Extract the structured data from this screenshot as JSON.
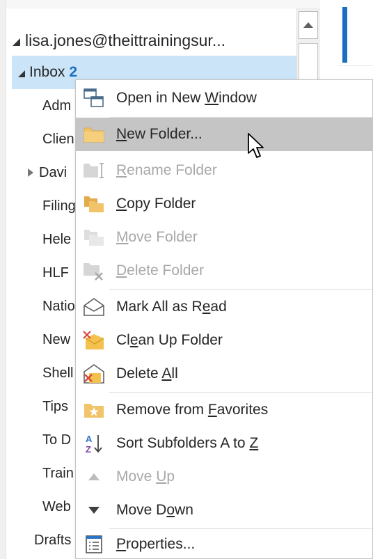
{
  "account": {
    "label": "lisa.jones@theittrainingsur..."
  },
  "inbox": {
    "label": "Inbox",
    "count": "2"
  },
  "folders": [
    {
      "label": "Adm"
    },
    {
      "label": "Clien"
    },
    {
      "label": "Davi",
      "expandable": true
    },
    {
      "label": "Filing"
    },
    {
      "label": "Hele"
    },
    {
      "label": "HLF"
    },
    {
      "label": "Natio"
    },
    {
      "label": "New"
    },
    {
      "label": "Shell"
    },
    {
      "label": "Tips"
    },
    {
      "label": "To D"
    },
    {
      "label": "Train"
    },
    {
      "label": "Web"
    },
    {
      "label": "Drafts"
    }
  ],
  "menu": {
    "items": [
      {
        "id": "open-new-window",
        "pre": "Open in New ",
        "mn": "W",
        "post": "indow",
        "icon": "open-window-icon",
        "enabled": true
      },
      {
        "id": "new-folder",
        "pre": "",
        "mn": "N",
        "post": "ew Folder...",
        "icon": "new-folder-icon",
        "enabled": true,
        "highlighted": true
      },
      {
        "id": "rename-folder",
        "pre": "",
        "mn": "R",
        "post": "ename Folder",
        "icon": "rename-folder-icon",
        "enabled": false
      },
      {
        "id": "copy-folder",
        "pre": "",
        "mn": "C",
        "post": "opy Folder",
        "icon": "copy-folder-icon",
        "enabled": true
      },
      {
        "id": "move-folder",
        "pre": "",
        "mn": "M",
        "post": "ove Folder",
        "icon": "move-folder-icon",
        "enabled": false
      },
      {
        "id": "delete-folder",
        "pre": "",
        "mn": "D",
        "post": "elete Folder",
        "icon": "delete-folder-icon",
        "enabled": false
      },
      {
        "id": "mark-all-read",
        "pre": "Mark All as R",
        "mn": "e",
        "post": "ad",
        "icon": "envelope-open-icon",
        "enabled": true
      },
      {
        "id": "clean-up-folder",
        "pre": "Cl",
        "mn": "e",
        "post": "an Up Folder",
        "icon": "clean-up-icon",
        "enabled": true
      },
      {
        "id": "delete-all",
        "pre": "Delete ",
        "mn": "A",
        "post": "ll",
        "icon": "delete-all-icon",
        "enabled": true
      },
      {
        "id": "remove-favorites",
        "pre": "Remove from ",
        "mn": "F",
        "post": "avorites",
        "icon": "favorites-folder-icon",
        "enabled": true
      },
      {
        "id": "sort-subfolders",
        "pre": "Sort Subfolders A to ",
        "mn": "Z",
        "post": "",
        "icon": "sort-az-icon",
        "enabled": true
      },
      {
        "id": "move-up",
        "pre": "Move ",
        "mn": "U",
        "post": "p",
        "icon": "triangle-up-icon",
        "enabled": false
      },
      {
        "id": "move-down",
        "pre": "Move D",
        "mn": "o",
        "post": "wn",
        "icon": "triangle-down-icon",
        "enabled": true
      },
      {
        "id": "properties",
        "pre": "",
        "mn": "P",
        "post": "roperties...",
        "icon": "properties-icon",
        "enabled": true
      }
    ]
  },
  "colors": {
    "selection": "#cce4f7",
    "menu_highlight": "#c5c5c5",
    "accent_blue": "#1a6fc1",
    "folder_yellow": "#f2c46a",
    "disabled_text": "#a8a8a8"
  }
}
